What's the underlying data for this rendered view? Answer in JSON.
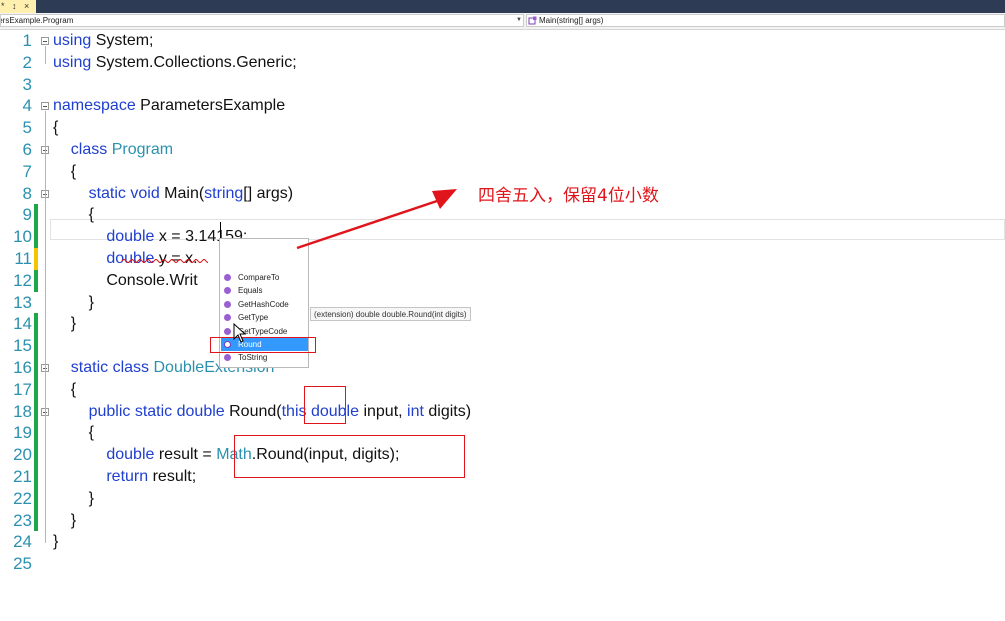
{
  "tab": {
    "label": "*",
    "pin_glyph": "↕",
    "close_glyph": "×"
  },
  "nav": {
    "class_selector": "ParametersExample.Program",
    "member_selector": "Main(string[] args)"
  },
  "lines": [
    {
      "num": "1",
      "tokens": [
        {
          "t": "using",
          "c": "kw"
        },
        {
          "t": " System;"
        }
      ]
    },
    {
      "num": "2",
      "tokens": [
        {
          "t": "using",
          "c": "kw"
        },
        {
          "t": " System.Collections.Generic;"
        }
      ]
    },
    {
      "num": "3",
      "tokens": []
    },
    {
      "num": "4",
      "tokens": [
        {
          "t": "namespace",
          "c": "kw"
        },
        {
          "t": " ParametersExample"
        }
      ]
    },
    {
      "num": "5",
      "tokens": [
        {
          "t": "{"
        }
      ]
    },
    {
      "num": "6",
      "tokens": [
        {
          "t": "    "
        },
        {
          "t": "class",
          "c": "kw"
        },
        {
          "t": " "
        },
        {
          "t": "Program",
          "c": "tp"
        }
      ]
    },
    {
      "num": "7",
      "tokens": [
        {
          "t": "    {"
        }
      ]
    },
    {
      "num": "8",
      "tokens": [
        {
          "t": "        "
        },
        {
          "t": "static",
          "c": "kw"
        },
        {
          "t": " "
        },
        {
          "t": "void",
          "c": "kw"
        },
        {
          "t": " Main("
        },
        {
          "t": "string",
          "c": "kw"
        },
        {
          "t": "[] args)"
        }
      ]
    },
    {
      "num": "9",
      "tokens": [
        {
          "t": "        {"
        }
      ]
    },
    {
      "num": "10",
      "tokens": [
        {
          "t": "            "
        },
        {
          "t": "double",
          "c": "kw"
        },
        {
          "t": " x = 3.14159;"
        }
      ]
    },
    {
      "num": "11",
      "tokens": [
        {
          "t": "            "
        },
        {
          "t": "double",
          "c": "kw"
        },
        {
          "t": " y = x."
        }
      ]
    },
    {
      "num": "12",
      "tokens": [
        {
          "t": "            Console.Writ"
        }
      ]
    },
    {
      "num": "13",
      "tokens": [
        {
          "t": "        }"
        }
      ]
    },
    {
      "num": "14",
      "tokens": [
        {
          "t": "    }"
        }
      ]
    },
    {
      "num": "15",
      "tokens": []
    },
    {
      "num": "16",
      "tokens": [
        {
          "t": "    "
        },
        {
          "t": "static",
          "c": "kw"
        },
        {
          "t": " "
        },
        {
          "t": "class",
          "c": "kw"
        },
        {
          "t": " "
        },
        {
          "t": "DoubleExtension",
          "c": "tp"
        }
      ]
    },
    {
      "num": "17",
      "tokens": [
        {
          "t": "    {"
        }
      ]
    },
    {
      "num": "18",
      "tokens": [
        {
          "t": "        "
        },
        {
          "t": "public",
          "c": "kw"
        },
        {
          "t": " "
        },
        {
          "t": "static",
          "c": "kw"
        },
        {
          "t": " "
        },
        {
          "t": "double",
          "c": "kw"
        },
        {
          "t": " Round("
        },
        {
          "t": "this",
          "c": "kw"
        },
        {
          "t": " "
        },
        {
          "t": "double",
          "c": "kw"
        },
        {
          "t": " input, "
        },
        {
          "t": "int",
          "c": "kw"
        },
        {
          "t": " digits)"
        }
      ]
    },
    {
      "num": "19",
      "tokens": [
        {
          "t": "        {"
        }
      ]
    },
    {
      "num": "20",
      "tokens": [
        {
          "t": "            "
        },
        {
          "t": "double",
          "c": "kw"
        },
        {
          "t": " result = "
        },
        {
          "t": "Math",
          "c": "tp"
        },
        {
          "t": ".Round(input, digits);"
        }
      ]
    },
    {
      "num": "21",
      "tokens": [
        {
          "t": "            "
        },
        {
          "t": "return",
          "c": "kw"
        },
        {
          "t": " result;"
        }
      ]
    },
    {
      "num": "22",
      "tokens": [
        {
          "t": "        }"
        }
      ]
    },
    {
      "num": "23",
      "tokens": [
        {
          "t": "    }"
        }
      ]
    },
    {
      "num": "24",
      "tokens": [
        {
          "t": "}"
        }
      ]
    },
    {
      "num": "25",
      "tokens": []
    }
  ],
  "intellisense": {
    "items": [
      "CompareTo",
      "Equals",
      "GetHashCode",
      "GetType",
      "GetTypeCode",
      "Round",
      "ToString"
    ],
    "selected": "Round",
    "tooltip": "(extension) double double.Round(int digits)"
  },
  "annotation": {
    "text": "四舍五入，保留4位小数",
    "color": "#e0151b"
  },
  "colors": {
    "keyword": "#1f3fcf",
    "type": "#2b91af",
    "line_number": "#2b91af",
    "change_saved": "#1fa64a",
    "change_unsaved": "#f5c400",
    "highlight": "#e0151b"
  }
}
